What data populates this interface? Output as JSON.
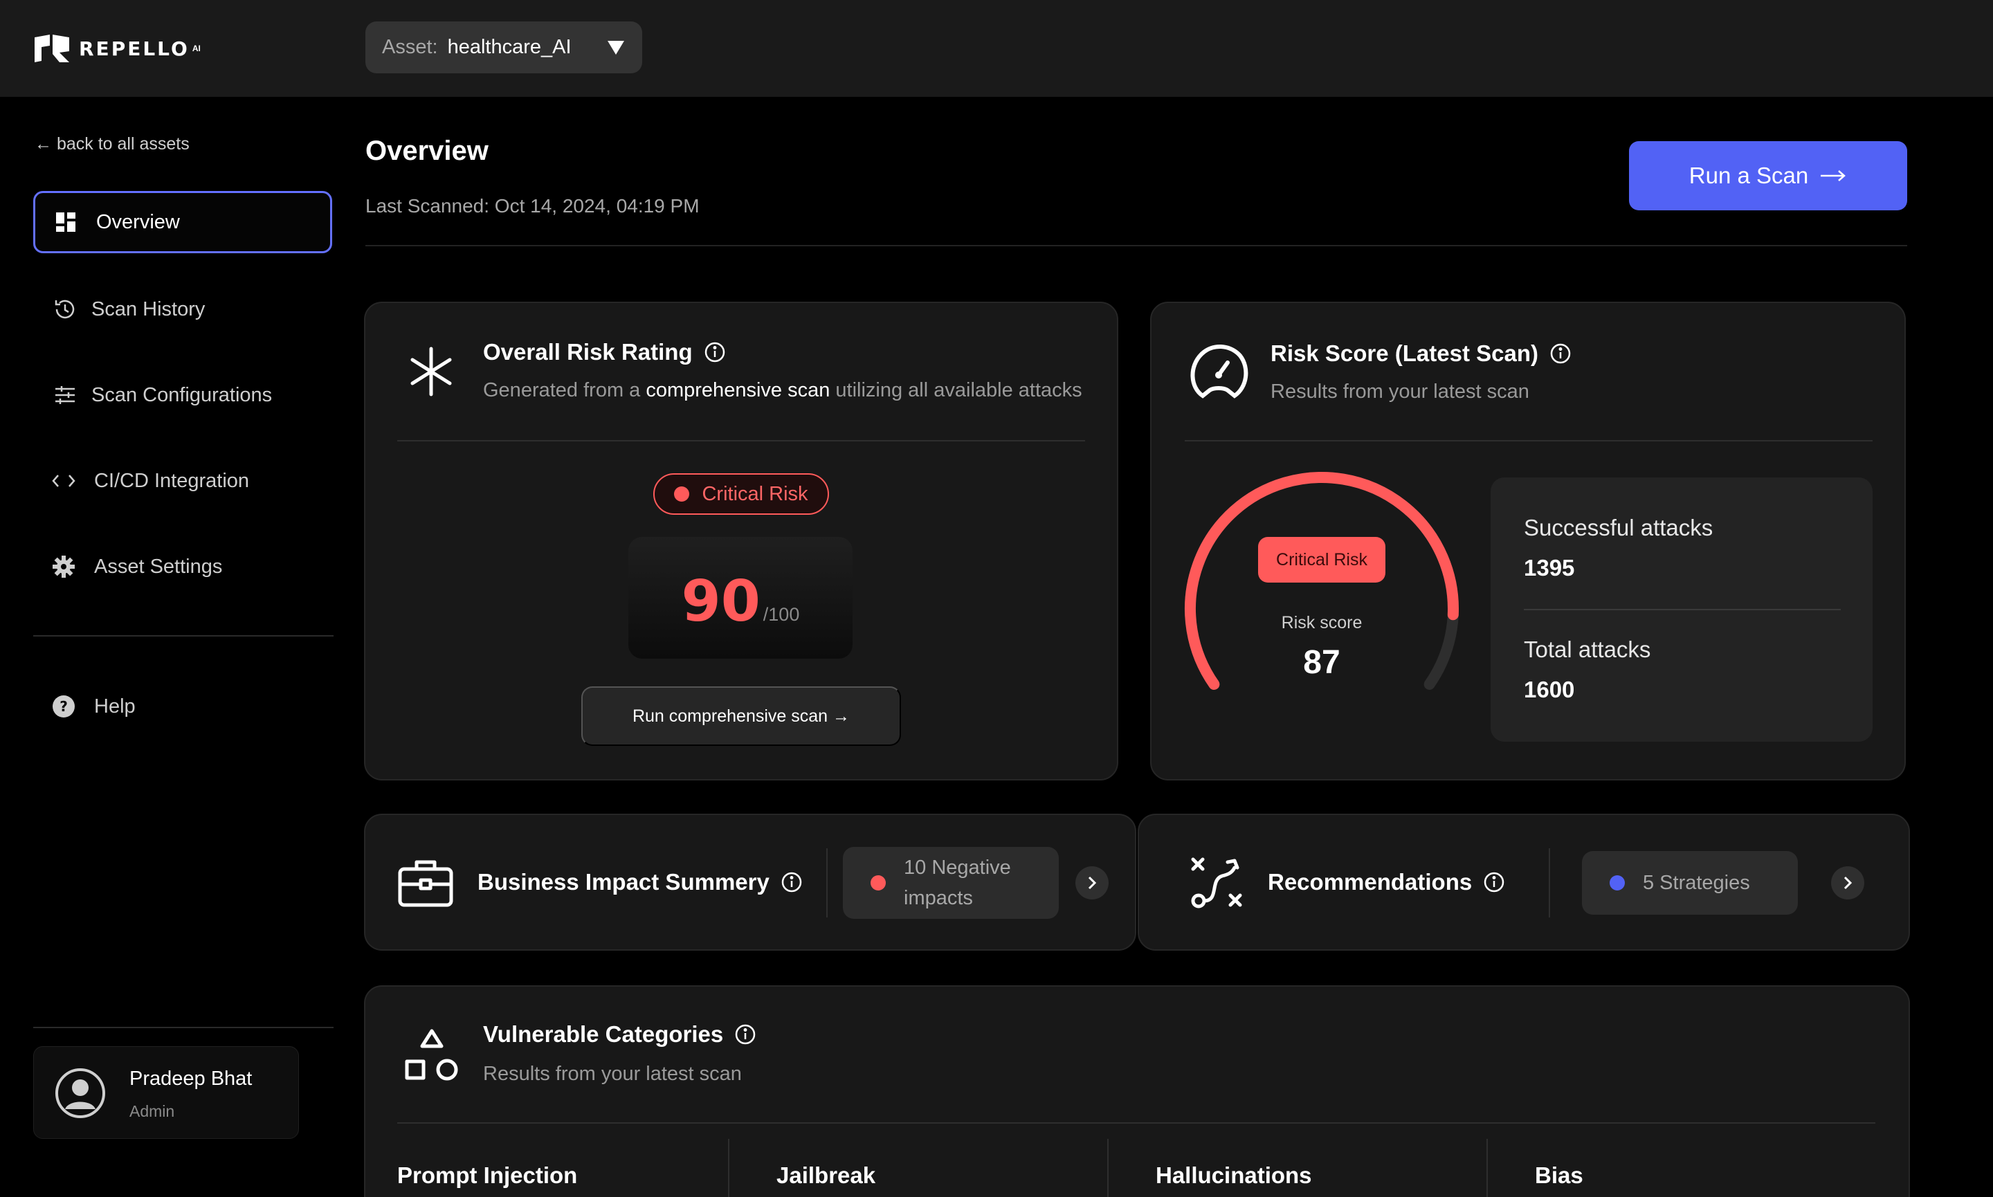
{
  "topbar": {
    "brand": "REPELLO",
    "brand_suffix": "AI",
    "asset_label": "Asset:",
    "asset_value": "healthcare_AI"
  },
  "sidebar": {
    "back_link": "← back to all assets",
    "items": [
      {
        "label": "Overview",
        "icon": "grid-icon",
        "active": true
      },
      {
        "label": "Scan History",
        "icon": "history-icon"
      },
      {
        "label": "Scan Configurations",
        "icon": "sliders-icon"
      },
      {
        "label": "CI/CD Integration",
        "icon": "code-icon"
      },
      {
        "label": "Asset Settings",
        "icon": "gear-icon"
      },
      {
        "label": "Help",
        "icon": "help-icon"
      }
    ],
    "user": {
      "name": "Pradeep Bhat",
      "role": "Admin"
    }
  },
  "header": {
    "title": "Overview",
    "last_scanned": "Last Scanned: Oct 14, 2024, 04:19 PM",
    "run_scan_label": "Run a Scan"
  },
  "risk_rating": {
    "title": "Overall Risk Rating",
    "sub_before": "Generated from a",
    "sub_highlight": "comprehensive scan",
    "sub_after": "utilizing all available attacks",
    "badge": "Critical Risk",
    "score": "90",
    "score_max": "/100",
    "action": "Run comprehensive scan →"
  },
  "risk_score": {
    "title": "Risk Score (Latest Scan)",
    "subtitle": "Results from your latest scan",
    "badge": "Critical Risk",
    "label": "Risk score",
    "value": "87",
    "gauge_fraction": 0.87,
    "successful_label": "Successful attacks",
    "successful_value": "1395",
    "total_label": "Total attacks",
    "total_value": "1600"
  },
  "business_impact": {
    "title": "Business Impact Summery",
    "chip_line1": "10 Negative",
    "chip_line2": "impacts"
  },
  "recommendations": {
    "title": "Recommendations",
    "chip": "5 Strategies"
  },
  "vulnerable": {
    "title": "Vulnerable Categories",
    "subtitle": "Results from your latest scan",
    "categories": [
      "Prompt Injection",
      "Jailbreak",
      "Hallucinations",
      "Bias"
    ]
  },
  "colors": {
    "accent": "#5262f5",
    "critical": "#ff5a5a",
    "card": "#181818"
  }
}
